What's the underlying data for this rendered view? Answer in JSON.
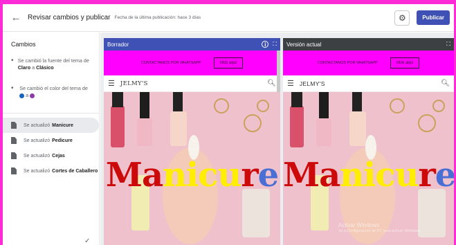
{
  "header": {
    "title": "Revisar cambios y publicar",
    "subtitle": "Fecha de la última publicación: hace 3 días",
    "publish_label": "Publicar"
  },
  "sidebar": {
    "heading": "Cambios",
    "font_change": {
      "prefix": "Se cambió la fuente del tema de ",
      "from": "Claro",
      "middle": " a ",
      "to": "Clásico"
    },
    "color_change": {
      "prefix": "Se cambió el color del tema de ",
      "middle": " a ",
      "from_color": "#1565c0",
      "to_color": "#8e3aa8"
    },
    "updated_prefix": "Se actualizó",
    "updates": [
      {
        "name": "Manicure",
        "active": true
      },
      {
        "name": "Pedicure",
        "active": false
      },
      {
        "name": "Cejas",
        "active": false
      },
      {
        "name": "Cortes de Caballero",
        "active": false
      }
    ]
  },
  "panels": {
    "draft_label": "Borrador",
    "current_label": "Versión actual"
  },
  "site": {
    "promo_text": "CONTACTANOS POR WHATSAPP",
    "promo_button": "click aqui",
    "brand": "JELMY'S",
    "hero_parts": [
      {
        "text": "Ma",
        "color": "r"
      },
      {
        "text": "nicu",
        "color": "y"
      },
      {
        "text": "r",
        "color": "r"
      },
      {
        "text": "e",
        "color": "b"
      }
    ]
  },
  "watermark": {
    "line1": "Activar Windows",
    "line2": "Ve a Configuración de PC para activar Windows."
  },
  "colors": {
    "frame": "#ff2bd6",
    "accent": "#3f51b5",
    "promo": "#ff00ff"
  }
}
